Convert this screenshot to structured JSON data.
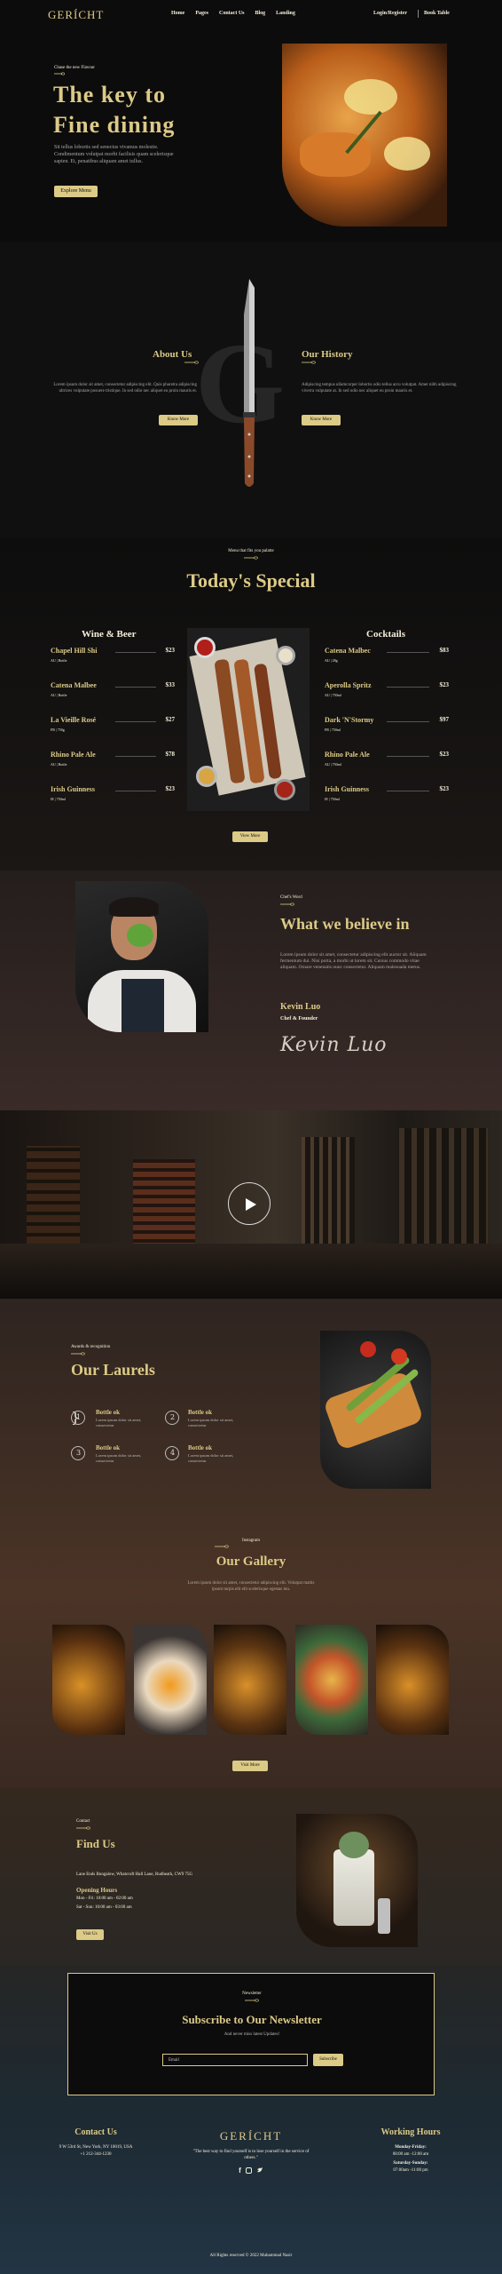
{
  "nav": {
    "logo": "GERÍCHT",
    "links": [
      "Home",
      "Pages",
      "Contact Us",
      "Blog",
      "Landing"
    ],
    "login": "Login/Register",
    "book": "Book Table"
  },
  "hero": {
    "kicker": "Chase the new Flavour",
    "title_line1": "The key to",
    "title_line2": "Fine dining",
    "text": "Sit tellus lobortis sed senectus vivamus molestie. Condimentum volutpat morbi facilisis quam scelerisque sapien. Et, penatibus aliquam amet tullus.",
    "button": "Explore Menu"
  },
  "about": {
    "big_letter": "G",
    "about_title": "About Us",
    "about_text": "Lorem ipsum dolor sit amet, consectetur adipiscing elit. Quis pharetra adipiscing ultrices vulputate posuere tristique. In sed odio nec aliquet eu proin mauris et.",
    "about_button": "Know More",
    "history_title": "Our History",
    "history_text": "Adipiscing tempus ullamcorper lobortis odio tellus arcu volutpat. Amet nibh adipiscing viverra vulputate at. In sed odio nec aliquet eu proin mauris et.",
    "history_button": "Know More"
  },
  "menu": {
    "kicker": "Menu that fits you palatte",
    "title": "Today's Special",
    "wine_heading": "Wine & Beer",
    "cocktail_heading": "Cocktails",
    "wine": [
      {
        "name": "Chapel Hill Shi",
        "price": "$23",
        "tags": "AU | Bottle"
      },
      {
        "name": "Catena Malbee",
        "price": "$33",
        "tags": "AU | Bottle"
      },
      {
        "name": "La Vieille Rosé",
        "price": "$27",
        "tags": "FR | 750g"
      },
      {
        "name": "Rhino Pale Ale",
        "price": "$78",
        "tags": "AU | Bottle"
      },
      {
        "name": "Irish Guinness",
        "price": "$23",
        "tags": "IE | 750ml"
      }
    ],
    "cocktails": [
      {
        "name": "Catena Malbec",
        "price": "$83",
        "tags": "AU | 28g"
      },
      {
        "name": "Aperolla Spritz",
        "price": "$23",
        "tags": "AU | 750ml"
      },
      {
        "name": "Dark 'N'Stormy",
        "price": "$97",
        "tags": "FR | 750ml"
      },
      {
        "name": "Rhino Pale Ale",
        "price": "$23",
        "tags": "AU | 750ml"
      },
      {
        "name": "Irish Guinness",
        "price": "$23",
        "tags": "IE | 750ml"
      }
    ],
    "button": "View More"
  },
  "chef": {
    "kicker": "Chef's Word",
    "title": "What we believe in",
    "text": "Lorem ipsum dolor sit amet, consectetur adipiscing elit auctor sit. Aliquam fermentum dui. Nisi porta, a morbi ut lorem sit. Cursus commodo vitae aliquam. Ornare venenatis nunc consectetur. Aliquam malesuada metus.",
    "name": "Kevin Luo",
    "role": "Chef & Founder",
    "signature": "Kevin Luo"
  },
  "laurels": {
    "kicker": "Awards & recognition",
    "title": "Our Laurels",
    "awards": [
      {
        "title": "Bottle ok",
        "text": "Lorem ipsum dolor sit amet, consectetur"
      },
      {
        "title": "Bottle ok",
        "text": "Lorem ipsum dolor sit amet, consectetur"
      },
      {
        "title": "Bottle ok",
        "text": "Lorem ipsum dolor sit amet, consectetur"
      },
      {
        "title": "Bottle ok",
        "text": "Lorem ipsum dolor sit amet, consectetur"
      }
    ]
  },
  "gallery": {
    "kicker": "Instagram",
    "title": "Our Gallery",
    "text": "Lorem ipsum dolor sit amet, consectetur adipiscing elit. Volutpat mattis ipsum turpis elit elit scelerisque egestas mu.",
    "button": "Visit More"
  },
  "find": {
    "kicker": "Contact",
    "title": "Find Us",
    "address": "Lane Ends Bungalow, Whatcroft Hall Lane, Rudheath, CW9 75G",
    "hours_title": "Opening Hours",
    "hours_line1": "Mon - Fri: 10:00 am - 02:00 am",
    "hours_line2": "Sat - Sun: 10:00 am - 03:00 am",
    "button": "Visit Us"
  },
  "newsletter": {
    "kicker": "Newsletter",
    "title": "Subscribe to Our Newsletter",
    "subtitle": "And never miss latest Updates!",
    "placeholder": "Email",
    "button": "Subscribe"
  },
  "footer": {
    "contact_title": "Contact Us",
    "address": "9 W 53rd St, New York, NY 10019, USA",
    "phone": "+1 212-344-1230",
    "logo": "GERÍCHT",
    "quote": "\"The best way to find yourself is to lose yourself in the service of others.\"",
    "hours_title": "Working Hours",
    "hours1": "Monday-Friday:",
    "hours2": "08:00 am -12:00 am",
    "hours3": "Saturday-Sunday:",
    "hours4": "07:00am -11:00 pm",
    "copyright": "All Rights reserved © 2022 Muhammad Nasir"
  },
  "colors": {
    "gold": "#dcca87",
    "black": "#0c0c0c",
    "cream": "#f5efdb"
  }
}
